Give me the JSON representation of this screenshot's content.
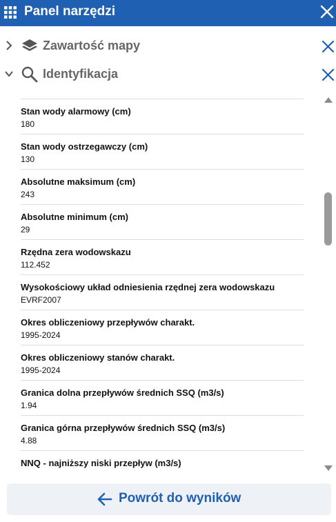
{
  "header": {
    "title": "Panel narzędzi",
    "bg_color": "#1f60b3"
  },
  "sections": [
    {
      "label": "Zawartość mapy",
      "icon": "layers-icon",
      "expanded": false
    },
    {
      "label": "Identyfikacja",
      "icon": "search-icon",
      "expanded": true
    }
  ],
  "items": [
    {
      "label": "Stan wody alarmowy (cm)",
      "value": "180"
    },
    {
      "label": "Stan wody ostrzegawczy (cm)",
      "value": "130"
    },
    {
      "label": "Absolutne maksimum (cm)",
      "value": "243"
    },
    {
      "label": "Absolutne minimum (cm)",
      "value": "29"
    },
    {
      "label": "Rzędna zera wodowskazu",
      "value": "112.452"
    },
    {
      "label": "Wysokościowy układ odniesienia rzędnej zera wodowskazu",
      "value": "EVRF2007"
    },
    {
      "label": "Okres obliczeniowy przepływów charakt.",
      "value": "1995-2024"
    },
    {
      "label": "Okres obliczeniowy stanów charakt.",
      "value": "1995-2024"
    },
    {
      "label": "Granica dolna przepływów średnich SSQ (m3/s)",
      "value": "1.94"
    },
    {
      "label": "Granica górna przepływów średnich SSQ (m3/s)",
      "value": "4.88"
    },
    {
      "label": "NNQ - najniższy niski przepływ (m3/s)",
      "value": ""
    }
  ],
  "footer": {
    "back_label": "Powrót do wyników",
    "accent_color": "#1f60b3"
  }
}
